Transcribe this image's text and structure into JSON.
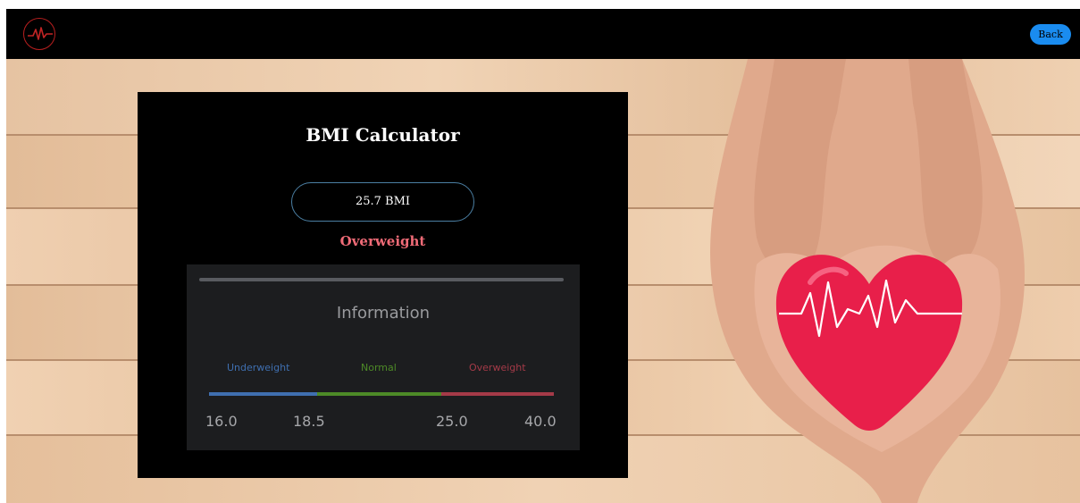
{
  "header": {
    "logo_icon": "heartbeat-logo-icon",
    "back_label": "Back",
    "accent_color": "#1a8cf0"
  },
  "card": {
    "title": "BMI Calculator",
    "bmi_value": "25.7 BMI",
    "status": "Overweight",
    "status_color": "#f06b77"
  },
  "info": {
    "title": "Information",
    "ranges": [
      {
        "label": "Underweight",
        "color": "#3f6fb0"
      },
      {
        "label": "Normal",
        "color": "#4d8a27"
      },
      {
        "label": "Overweight",
        "color": "#a53a48"
      }
    ],
    "ticks": [
      "16.0",
      "18.5",
      "25.0",
      "40.0"
    ]
  },
  "background": {
    "image_icon": "hands-holding-heart-image"
  }
}
